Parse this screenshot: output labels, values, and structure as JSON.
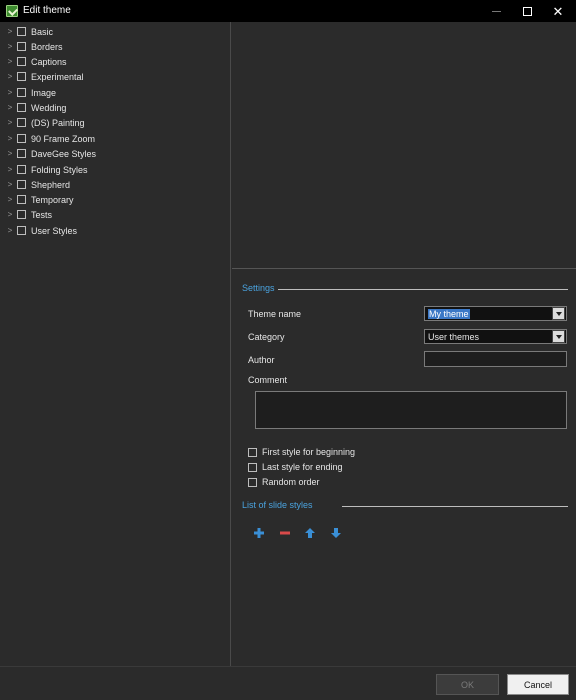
{
  "window": {
    "title": "Edit theme"
  },
  "tree": {
    "items": [
      {
        "label": "Basic"
      },
      {
        "label": "Borders"
      },
      {
        "label": "Captions"
      },
      {
        "label": "Experimental"
      },
      {
        "label": "Image"
      },
      {
        "label": "Wedding"
      },
      {
        "label": "(DS) Painting"
      },
      {
        "label": "90 Frame Zoom"
      },
      {
        "label": "DaveGee Styles"
      },
      {
        "label": "Folding Styles"
      },
      {
        "label": "Shepherd"
      },
      {
        "label": "Temporary"
      },
      {
        "label": "Tests"
      },
      {
        "label": "User Styles"
      }
    ]
  },
  "settings": {
    "section_title": "Settings",
    "theme_name_label": "Theme name",
    "theme_name_value": "My theme",
    "category_label": "Category",
    "category_value": "User themes",
    "author_label": "Author",
    "author_value": "",
    "comment_label": "Comment",
    "comment_value": "",
    "checkboxes": [
      {
        "label": "First style for beginning",
        "checked": false
      },
      {
        "label": "Last style for ending",
        "checked": false
      },
      {
        "label": "Random order",
        "checked": false
      }
    ]
  },
  "slide_styles": {
    "section_title": "List of slide styles",
    "icons": [
      "plus-icon",
      "minus-icon",
      "arrow-up-icon",
      "arrow-down-icon"
    ],
    "colors": {
      "plus": "#3a8fd6",
      "minus": "#d94a4a",
      "arrows": "#3a8fd6"
    }
  },
  "footer": {
    "ok_label": "OK",
    "cancel_label": "Cancel"
  },
  "colors": {
    "background": "#2b2b2b",
    "titlebar": "#000000",
    "accent_text": "#4aa3df",
    "selection": "#3b78c6"
  }
}
